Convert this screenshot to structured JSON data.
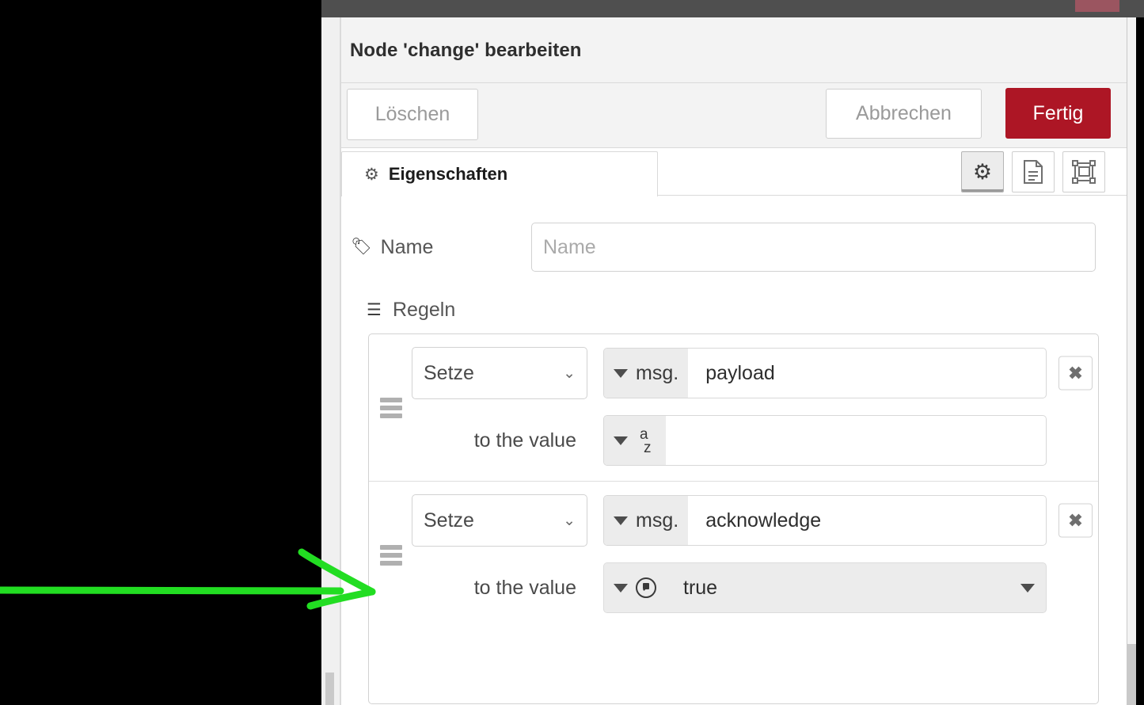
{
  "window": {
    "chrome_color": "#4f4f4f",
    "accent_red": "#ad1625"
  },
  "dialog": {
    "title": "Node 'change' bearbeiten",
    "buttons": {
      "delete_label": "Löschen",
      "cancel_label": "Abbrechen",
      "done_label": "Fertig"
    }
  },
  "tabs": {
    "active_label": "Eigenschaften",
    "icon_buttons": [
      {
        "name": "properties-gear-icon",
        "active": true
      },
      {
        "name": "description-document-icon",
        "active": false
      },
      {
        "name": "appearance-layout-icon",
        "active": false
      }
    ]
  },
  "form": {
    "name": {
      "label": "Name",
      "placeholder": "Name",
      "value": ""
    },
    "rules_label": "Regeln",
    "rules": [
      {
        "action": "Setze",
        "property_type": "msg.",
        "property": "payload",
        "value_label": "to the value",
        "value_type": "az-string-icon",
        "value": "",
        "has_end_caret": false,
        "delete_label": "✖"
      },
      {
        "action": "Setze",
        "property_type": "msg.",
        "property": "acknowledge",
        "value_label": "to the value",
        "value_type": "boolean-icon",
        "value": "true",
        "has_end_caret": true,
        "delete_label": "✖"
      }
    ]
  },
  "annotation": {
    "color": "#22dd22",
    "points_to": "drag-handle of rule 2"
  }
}
